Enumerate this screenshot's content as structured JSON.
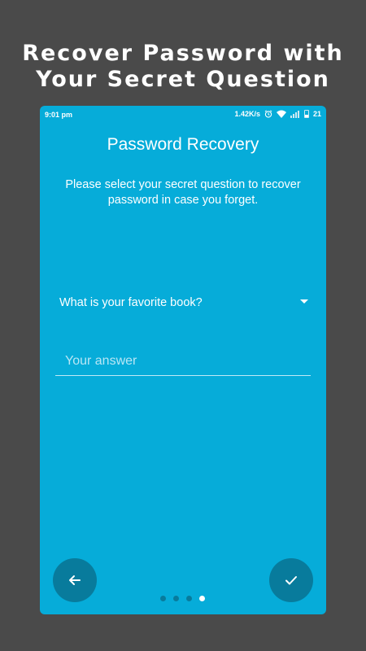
{
  "promo": {
    "title_line1": "Recover Password with",
    "title_line2": "Your Secret Question"
  },
  "status_bar": {
    "time": "9:01 pm",
    "network_speed": "1.42K/s",
    "battery_level": "21",
    "icons": [
      "alarm-icon",
      "wifi-icon",
      "signal-icon",
      "battery-icon"
    ]
  },
  "screen": {
    "title": "Password Recovery",
    "description": "Please select your secret question to recover password in case you forget.",
    "question_selected": "What is your favorite book?",
    "answer_placeholder": "Your answer",
    "answer_value": ""
  },
  "navigation": {
    "back_icon": "arrow-left-icon",
    "done_icon": "check-icon",
    "page_count": 4,
    "current_page": 4
  },
  "colors": {
    "background": "#4a4a4a",
    "screen": "#06acd9",
    "button": "#087b9c",
    "text": "#ffffff"
  }
}
